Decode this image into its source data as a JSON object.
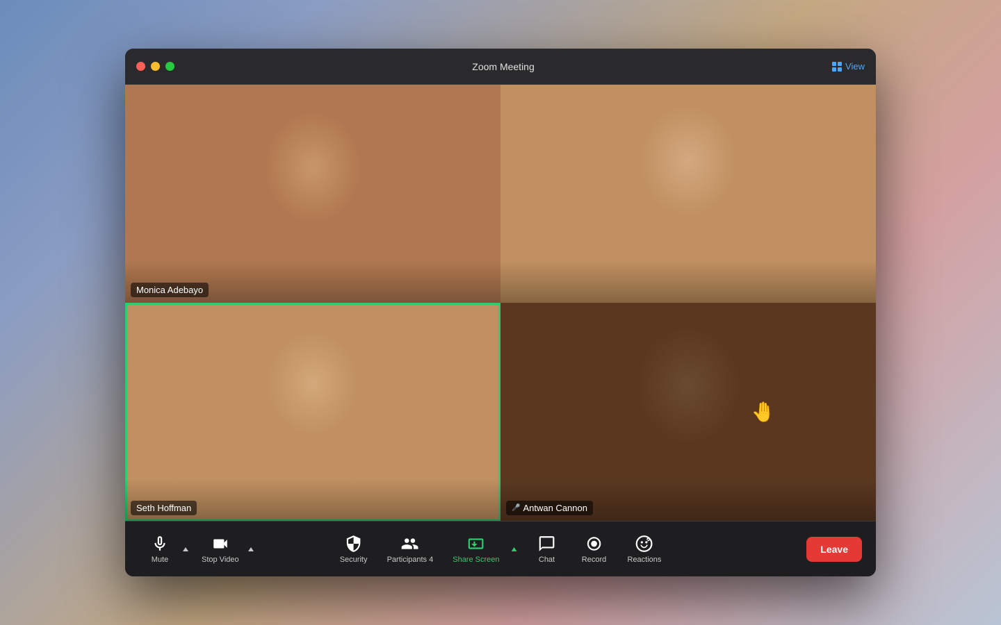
{
  "window": {
    "title": "Zoom Meeting",
    "view_label": "View"
  },
  "participants": [
    {
      "name": "Monica Adebayo",
      "position": "top-left",
      "active_speaker": false,
      "muted": false
    },
    {
      "name": "",
      "position": "top-right",
      "active_speaker": false,
      "muted": false
    },
    {
      "name": "Seth Hoffman",
      "position": "bottom-left",
      "active_speaker": true,
      "muted": false
    },
    {
      "name": "Antwan Cannon",
      "position": "bottom-right",
      "active_speaker": false,
      "muted": false,
      "has_reaction": true
    }
  ],
  "toolbar": {
    "mute_label": "Mute",
    "stop_video_label": "Stop Video",
    "security_label": "Security",
    "participants_label": "Participants",
    "participants_count": "4",
    "share_screen_label": "Share Screen",
    "chat_label": "Chat",
    "record_label": "Record",
    "reactions_label": "Reactions",
    "leave_label": "Leave"
  },
  "colors": {
    "active_speaker_border": "#2ecc71",
    "share_screen_active": "#2ecc71",
    "leave_button": "#e53935"
  }
}
